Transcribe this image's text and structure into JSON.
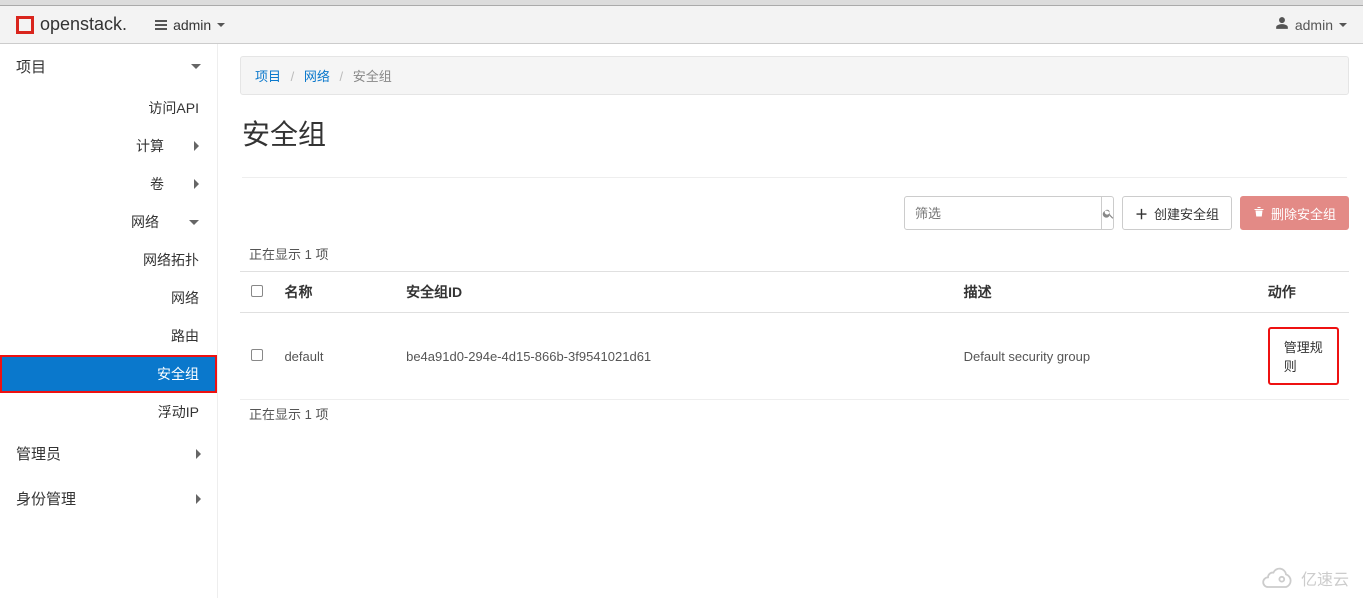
{
  "brand": {
    "name": "openstack."
  },
  "header": {
    "project_selector": "admin",
    "user_label": "admin"
  },
  "sidebar": {
    "top_project": "项目",
    "api_access": "访问API",
    "compute": "计算",
    "volumes": "卷",
    "network": "网络",
    "network_children": {
      "topology": "网络拓扑",
      "networks": "网络",
      "routers": "路由",
      "security_groups": "安全组",
      "floating_ip": "浮动IP"
    },
    "admin": "管理员",
    "identity": "身份管理"
  },
  "breadcrumb": {
    "item1": "项目",
    "item2": "网络",
    "item3": "安全组"
  },
  "page": {
    "title": "安全组"
  },
  "toolbar": {
    "filter_placeholder": "筛选",
    "create_label": "创建安全组",
    "delete_label": "删除安全组"
  },
  "table": {
    "count_text_top": "正在显示 1 项",
    "count_text_bottom": "正在显示 1 项",
    "headers": {
      "name": "名称",
      "id": "安全组ID",
      "desc": "描述",
      "action": "动作"
    },
    "rows": [
      {
        "name": "default",
        "id": "be4a91d0-294e-4d15-866b-3f9541021d61",
        "desc": "Default security group",
        "action": "管理规则"
      }
    ]
  },
  "watermark": "亿速云"
}
